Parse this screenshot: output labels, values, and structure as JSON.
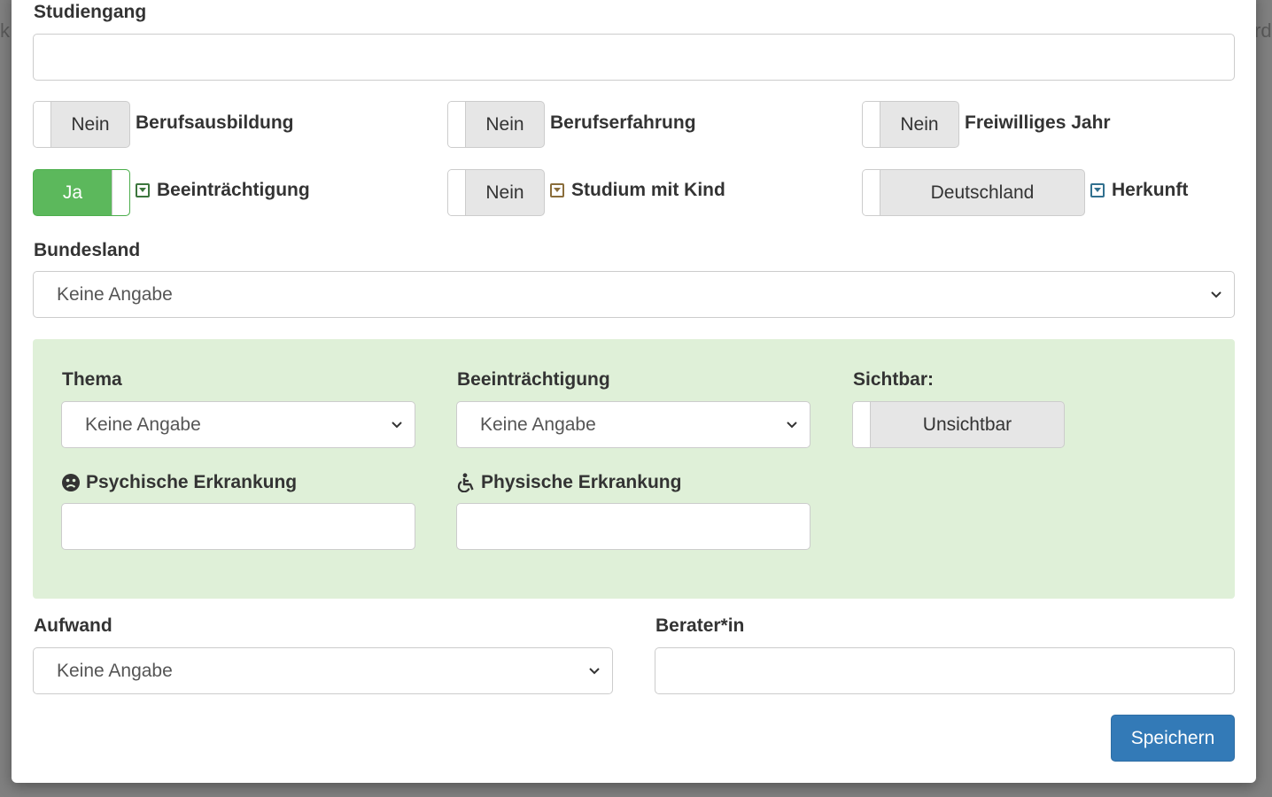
{
  "background": {
    "ghost_left": "ki",
    "ghost_right": "rd"
  },
  "form": {
    "studiengang": {
      "label": "Studiengang",
      "value": ""
    },
    "switches_row1": [
      {
        "state": "Nein",
        "label": "Berufsausbildung"
      },
      {
        "state": "Nein",
        "label": "Berufserfahrung"
      },
      {
        "state": "Nein",
        "label": "Freiwilliges Jahr"
      }
    ],
    "switches_row2": [
      {
        "state": "Ja",
        "label": "Beeinträchtigung",
        "caret_color": "#3c763d"
      },
      {
        "state": "Nein",
        "label": "Studium mit Kind",
        "caret_color": "#8a6d3b"
      },
      {
        "state": "Deutschland",
        "label": "Herkunft",
        "caret_color": "#31708f"
      }
    ],
    "bundesland": {
      "label": "Bundesland",
      "selected": "Keine Angabe"
    },
    "panel": {
      "thema": {
        "label": "Thema",
        "selected": "Keine Angabe"
      },
      "beeintraechtigung": {
        "label": "Beeinträchtigung",
        "selected": "Keine Angabe"
      },
      "sichtbar": {
        "label": "Sichtbar:",
        "state": "Unsichtbar"
      },
      "psychische": {
        "label": "Psychische Erkrankung",
        "icon": "sad-face-icon",
        "value": ""
      },
      "physische": {
        "label": "Physische Erkrankung",
        "icon": "wheelchair-icon",
        "value": ""
      }
    },
    "aufwand": {
      "label": "Aufwand",
      "selected": "Keine Angabe"
    },
    "berater": {
      "label": "Berater*in",
      "value": ""
    },
    "save_label": "Speichern"
  },
  "colors": {
    "toggle_on": "#5cb85c",
    "panel_bg": "#dff0d8",
    "primary": "#337ab7"
  }
}
